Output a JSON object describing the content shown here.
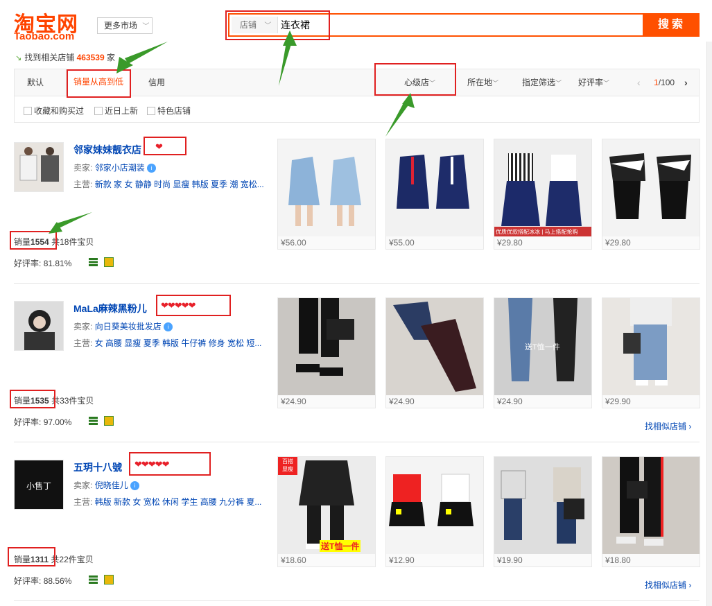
{
  "header": {
    "logo_cn": "淘宝网",
    "logo_en": "Taobao.com",
    "more_market": "更多市场",
    "search_type": "店铺",
    "search_query": "连衣裙",
    "search_button": "搜索"
  },
  "summary": {
    "prefix": "找到相关店铺",
    "count": "463539",
    "suffix": "家"
  },
  "sort": {
    "items": [
      "默认",
      "销量从高到低",
      "信用"
    ],
    "right": [
      "心级店",
      "所在地",
      "指定筛选",
      "好评率"
    ],
    "page_current": "1",
    "page_total": "/100"
  },
  "filters": [
    "收藏和购买过",
    "近日上新",
    "特色店铺"
  ],
  "shops": [
    {
      "name": "邻家妹妹靓衣店",
      "hearts": 1,
      "seller_label": "卖家:",
      "seller": "邻家小店潮装",
      "main_label": "主营:",
      "main_keywords": "新款 家 女 静静 时尚 显瘦 韩版 夏季 潮 宽松...",
      "sales_label": "销量",
      "sales": "1554",
      "items_label": "共18件宝贝",
      "rating_label": "好评率:",
      "rating": "81.81%",
      "find_similar": "",
      "products": [
        {
          "price": "¥56.00",
          "overlay": ""
        },
        {
          "price": "¥55.00",
          "overlay": ""
        },
        {
          "price": "¥29.80",
          "overlay": "优质优款搭配冰冰 | 马上搭配抢购"
        },
        {
          "price": "¥29.80",
          "overlay": ""
        }
      ]
    },
    {
      "name": "MaLa麻辣黑粉儿",
      "hearts": 5,
      "seller_label": "卖家:",
      "seller": "向日葵美妆批发店",
      "main_label": "主营:",
      "main_keywords": "女 高腰 显瘦 夏季 韩版 牛仔裤 修身 宽松 短...",
      "sales_label": "销量",
      "sales": "1535",
      "items_label": "共33件宝贝",
      "rating_label": "好评率:",
      "rating": "97.00%",
      "find_similar": "找相似店铺 ›",
      "products": [
        {
          "price": "¥24.90",
          "overlay": ""
        },
        {
          "price": "¥24.90",
          "overlay": ""
        },
        {
          "price": "¥24.90",
          "overlay": "送T恤一件"
        },
        {
          "price": "¥29.90",
          "overlay": ""
        }
      ]
    },
    {
      "name": "五玥十八號",
      "hearts": 5,
      "seller_label": "卖家:",
      "seller": "倪晓佳儿",
      "main_label": "主营:",
      "main_keywords": "韩版 新款 女 宽松 休闲 学生 高腰 九分裤 夏...",
      "sales_label": "销量",
      "sales": "1311",
      "items_label": "共22件宝贝",
      "rating_label": "好评率:",
      "rating": "88.56%",
      "find_similar": "找相似店铺 ›",
      "avatar_text": "小售丁",
      "products": [
        {
          "price": "¥18.60",
          "overlay": "送T恤一件",
          "badge": "百搭 显瘦"
        },
        {
          "price": "¥12.90",
          "overlay": ""
        },
        {
          "price": "¥19.90",
          "overlay": ""
        },
        {
          "price": "¥18.80",
          "overlay": ""
        }
      ]
    }
  ],
  "colors": {
    "accent": "#ff5000",
    "annotation_red": "#e02020",
    "annotation_arrow": "#3a9a2a",
    "link": "#0046b4"
  }
}
